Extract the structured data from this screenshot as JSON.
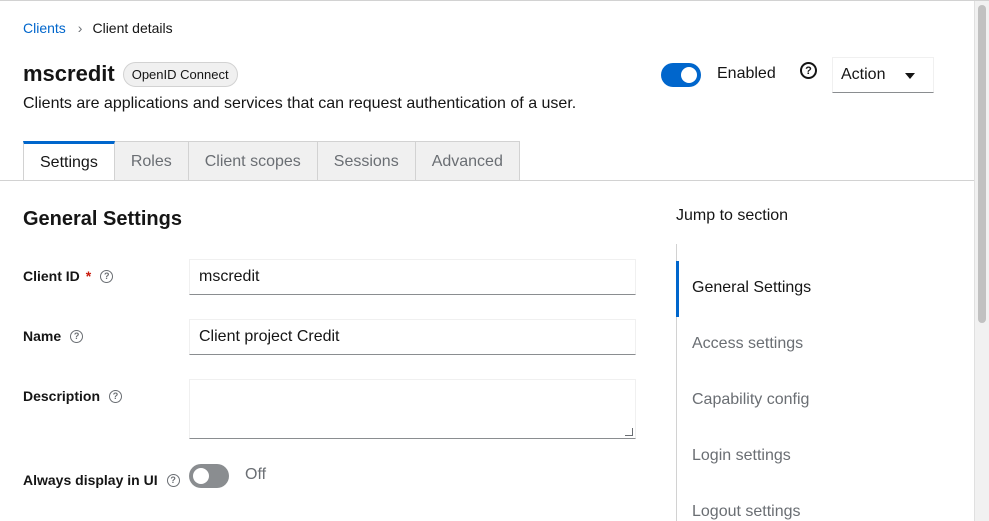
{
  "breadcrumb": {
    "parent": "Clients",
    "separator": "›",
    "current": "Client details"
  },
  "header": {
    "title": "mscredit",
    "badge": "OpenID Connect",
    "subtitle": "Clients are applications and services that can request authentication of a user.",
    "enabled_label": "Enabled",
    "enabled": true,
    "help_icon": "?",
    "action_label": "Action"
  },
  "tabs": [
    {
      "label": "Settings",
      "active": true
    },
    {
      "label": "Roles"
    },
    {
      "label": "Client scopes"
    },
    {
      "label": "Sessions"
    },
    {
      "label": "Advanced"
    }
  ],
  "section": {
    "title": "General Settings",
    "fields": {
      "client_id": {
        "label": "Client ID",
        "required_mark": "*",
        "value": "mscredit"
      },
      "name": {
        "label": "Name",
        "value": "Client project Credit"
      },
      "description": {
        "label": "Description",
        "value": ""
      },
      "always_display": {
        "label": "Always display in UI",
        "state_label": "Off",
        "on": false
      }
    }
  },
  "jump": {
    "title": "Jump to section",
    "items": [
      {
        "label": "General Settings",
        "active": true
      },
      {
        "label": "Access settings"
      },
      {
        "label": "Capability config"
      },
      {
        "label": "Login settings"
      },
      {
        "label": "Logout settings"
      }
    ]
  },
  "colors": {
    "accent": "#0066cc",
    "required": "#c9190b",
    "muted": "#6a6e73"
  }
}
